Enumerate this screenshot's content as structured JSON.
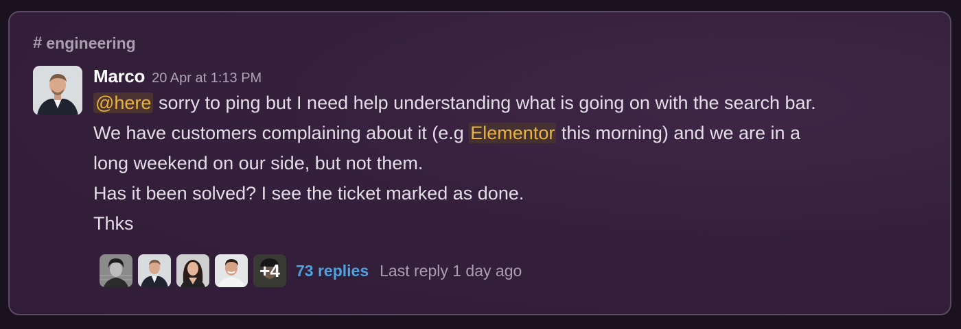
{
  "channel": {
    "hash": "#",
    "name": "engineering"
  },
  "message": {
    "author": "Marco",
    "timestamp": "20 Apr at 1:13 PM",
    "mention": "@here",
    "line1_rest": " sorry to ping but I need help understanding what is going on with the search bar.",
    "line2_before": "We have customers complaining about it (e.g ",
    "line2_link": "Elementor",
    "line2_after": " this morning) and we are in a",
    "line3": "long weekend on our side, but not them.",
    "line4": "Has it been solved? I see the ticket marked as done.",
    "line5": "Thks"
  },
  "thread": {
    "extra_participants": "+4",
    "replies": "73 replies",
    "last_reply": "Last reply 1 day ago"
  },
  "colors": {
    "card_bg": "#35203c",
    "mention": "#e9b43e",
    "replies_link": "#4ea3de"
  }
}
